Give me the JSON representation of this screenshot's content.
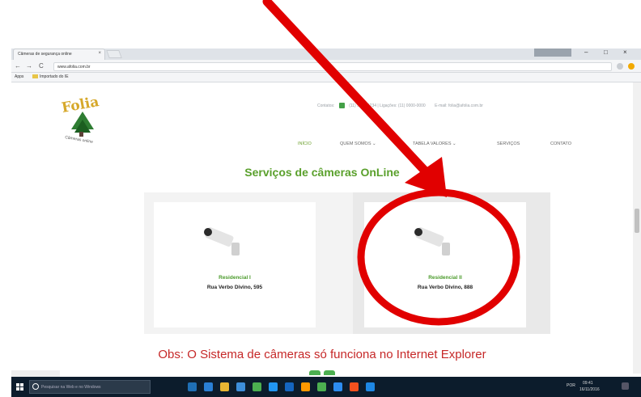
{
  "browser": {
    "tab_title": "Câmeras de segurança online",
    "tab_close": "×",
    "window_controls": {
      "minimize": "–",
      "maximize": "□",
      "close": "×"
    },
    "nav": {
      "back": "←",
      "forward": "→",
      "reload": "C"
    },
    "address": "www.afolia.com.br",
    "bookmarks": {
      "apps": "Apps",
      "folder": "Importado do IE"
    }
  },
  "site": {
    "logo_text": "Folia",
    "logo_subtitle": "Câmeras online",
    "contact": {
      "phone_label": "Contatos:",
      "phones": "(11) 9000-1234 | Ligações: (11) 0000-0000",
      "email": "E-mail: folia@afolia.com.br"
    },
    "menu": [
      {
        "label": "INÍCIO",
        "active": true
      },
      {
        "label": "QUEM SOMOS ⌄",
        "active": false
      },
      {
        "label": "TABELA VALORES ⌄",
        "active": false
      },
      {
        "label": "SERVIÇOS",
        "active": false
      },
      {
        "label": "CONTATO",
        "active": false
      }
    ],
    "section_title": "Serviços de câmeras OnLine",
    "cards": [
      {
        "title": "Residencial I",
        "address": "Rua Verbo Divino, 595"
      },
      {
        "title": "Residencial II",
        "address": "Rua Verbo Divino, 888"
      }
    ],
    "note": "Obs: O Sistema de câmeras só funciona no Internet Explorer"
  },
  "taskbar": {
    "search_placeholder": "Pesquisar na Web e no Windows",
    "time": "09:41",
    "date": "16/11/2016",
    "lang": "POR"
  },
  "colors": {
    "brand_green": "#5aa02c",
    "note_red": "#c62828",
    "annotation_red": "#e10000"
  }
}
